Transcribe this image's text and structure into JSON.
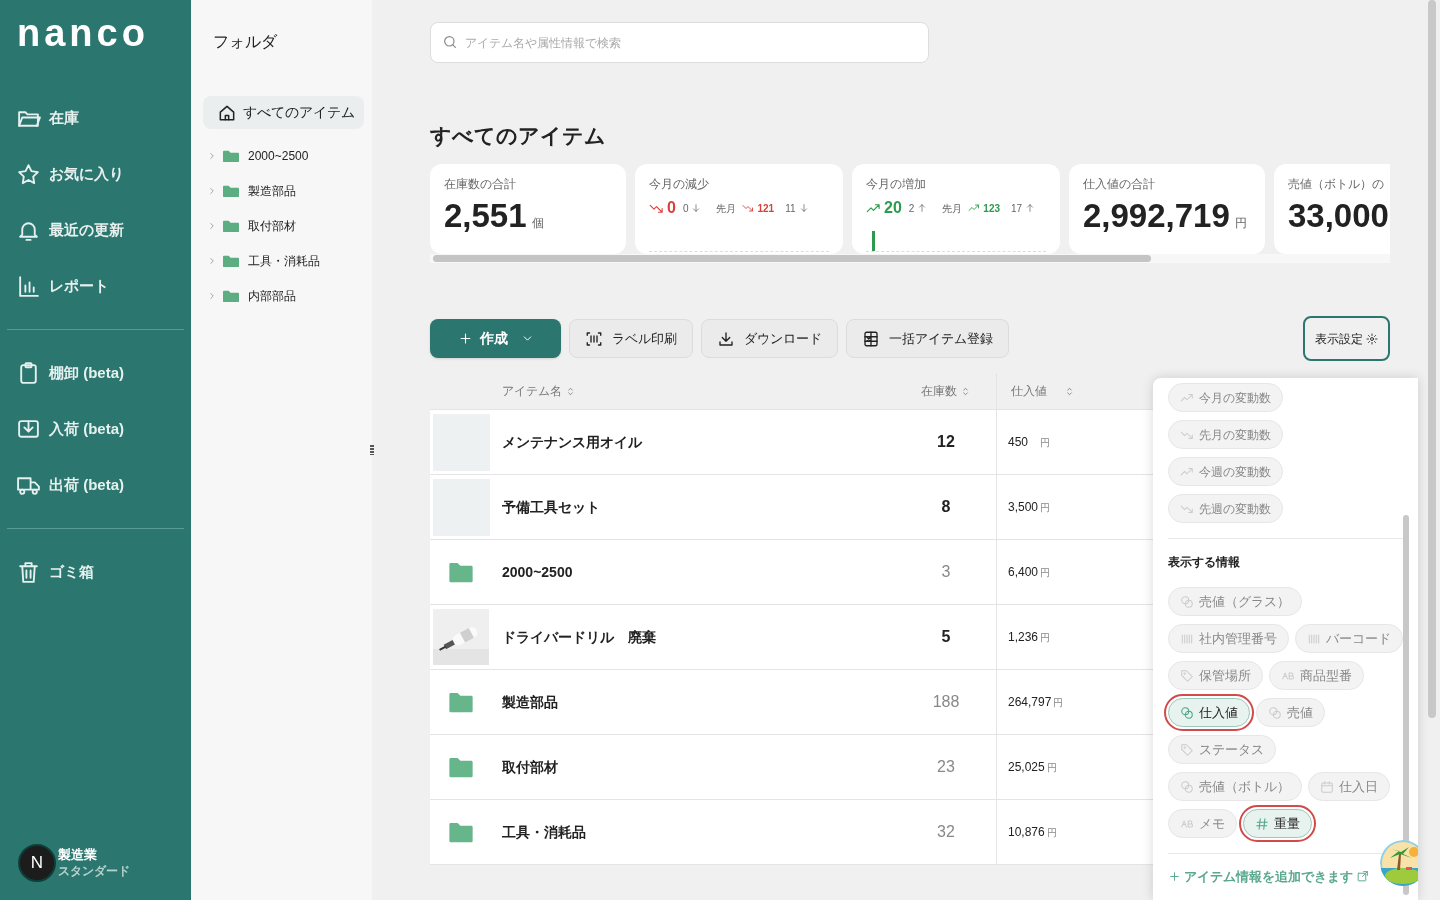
{
  "logo": "nanco",
  "nav": [
    [
      {
        "label": "在庫",
        "kind": "folder"
      },
      {
        "label": "お気に入り",
        "kind": "star"
      },
      {
        "label": "最近の更新",
        "kind": "bell"
      },
      {
        "label": "レポート",
        "kind": "chart"
      }
    ],
    [
      {
        "label": "棚卸 (beta)",
        "kind": "clipboard"
      },
      {
        "label": "入荷 (beta)",
        "kind": "inbox"
      },
      {
        "label": "出荷 (beta)",
        "kind": "truck"
      }
    ],
    [
      {
        "label": "ゴミ箱",
        "kind": "trash"
      }
    ]
  ],
  "account": {
    "avatar": "N",
    "name": "製造業",
    "plan": "スタンダード"
  },
  "folder_panel": {
    "title": "フォルダ",
    "root": {
      "label": "すべてのアイテム",
      "selected": true
    },
    "folders": [
      {
        "label": "2000~2500",
        "selected": false
      },
      {
        "label": "製造部品",
        "selected": false
      },
      {
        "label": "取付部材",
        "selected": false
      },
      {
        "label": "工具・消耗品",
        "selected": false
      },
      {
        "label": "内部部品",
        "selected": false
      }
    ]
  },
  "search": {
    "placeholder": "アイテム名や属性情報で検索"
  },
  "heading": "すべてのアイテム",
  "stats": [
    {
      "kind": "total",
      "label": "在庫数の合計",
      "value": "2,551",
      "unit": "個"
    },
    {
      "kind": "decrease",
      "label": "今月の減少",
      "value": "0",
      "count": "0",
      "last_label": "先月",
      "last_value": "121",
      "last_count": "11"
    },
    {
      "kind": "increase",
      "label": "今月の増加",
      "value": "20",
      "count": "2",
      "last_label": "先月",
      "last_value": "123",
      "last_count": "17"
    },
    {
      "kind": "total",
      "label": "仕入値の合計",
      "value": "2,992,719",
      "unit": "円"
    },
    {
      "kind": "total",
      "label": "売値（ボトル）の",
      "value": "33,000"
    }
  ],
  "toolbar": [
    {
      "kind": "create",
      "label": "作成"
    },
    {
      "kind": "label",
      "label": "ラベル印刷"
    },
    {
      "kind": "download",
      "label": "ダウンロード"
    },
    {
      "kind": "excel",
      "label": "一括アイテム登録"
    }
  ],
  "display_settings": {
    "label": "表示設定"
  },
  "table": {
    "columns": [
      "アイテム名",
      "在庫数",
      "仕入値"
    ],
    "rows": [
      {
        "kind": "blank",
        "name": "メンテナンス用オイル",
        "qty": "12",
        "price": "450",
        "unit": "円"
      },
      {
        "kind": "blank",
        "name": "予備工具セット",
        "qty": "8",
        "price": "3,500",
        "unit": "円"
      },
      {
        "kind": "folder",
        "name": "2000~2500",
        "qty": "3",
        "price": "6,400",
        "unit": "円"
      },
      {
        "name": "ドライバードリル　廃棄",
        "qty": "5",
        "price": "1,236",
        "unit": "円"
      },
      {
        "kind": "folder",
        "name": "製造部品",
        "qty": "188",
        "price": "264,797",
        "unit": "円"
      },
      {
        "kind": "folder",
        "name": "取付部材",
        "qty": "23",
        "price": "25,025",
        "unit": "円"
      },
      {
        "kind": "folder",
        "name": "工具・消耗品",
        "qty": "32",
        "price": "10,876",
        "unit": "円"
      }
    ]
  },
  "popover": {
    "trend_chips": [
      {
        "kind": "up",
        "label": "今月の変動数",
        "selected": false
      },
      {
        "kind": "down",
        "label": "先月の変動数",
        "selected": false
      },
      {
        "kind": "up",
        "label": "今週の変動数",
        "selected": false
      },
      {
        "kind": "down",
        "label": "先週の変動数",
        "selected": false
      }
    ],
    "info_title": "表示する情報",
    "info_chips": [
      [
        {
          "kind": "money",
          "label": "売値（グラス）",
          "selected": false
        }
      ],
      [
        {
          "kind": "barcode",
          "label": "社内管理番号",
          "selected": false
        },
        {
          "kind": "barcode",
          "label": "バーコード",
          "selected": false
        }
      ],
      [
        {
          "kind": "tag",
          "label": "保管場所",
          "selected": false
        },
        {
          "kind": "text",
          "label": "商品型番",
          "selected": false
        }
      ],
      [
        {
          "kind": "money",
          "label": "仕入値",
          "selected": true
        },
        {
          "kind": "money",
          "label": "売値",
          "selected": false
        }
      ],
      [
        {
          "kind": "tag",
          "label": "ステータス",
          "selected": false
        }
      ],
      [
        {
          "kind": "money",
          "label": "売値（ボトル）",
          "selected": false
        },
        {
          "kind": "calendar",
          "label": "仕入日",
          "selected": false
        }
      ],
      [
        {
          "kind": "text",
          "label": "メモ",
          "selected": false
        },
        {
          "kind": "number",
          "label": "重量",
          "selected": true
        }
      ]
    ],
    "add_link": "アイテム情報を追加できます"
  }
}
